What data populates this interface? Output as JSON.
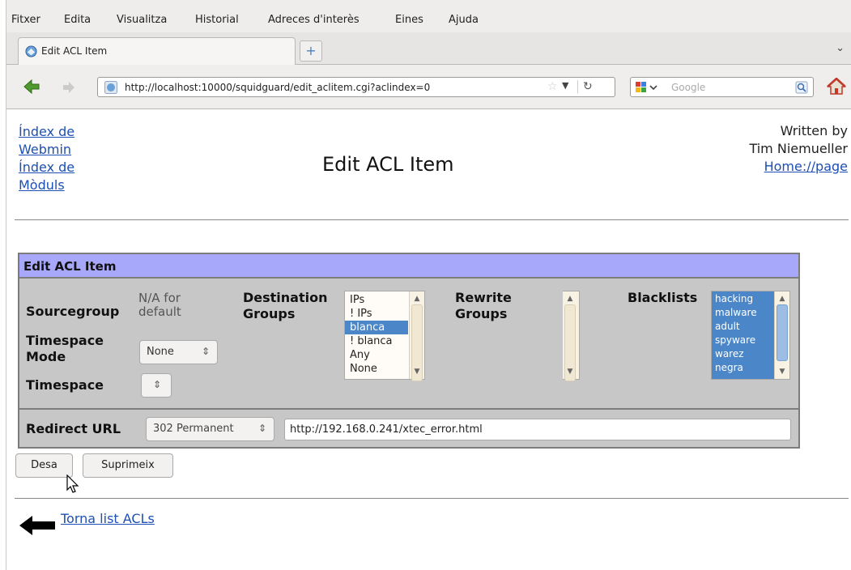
{
  "menu": [
    "Fitxer",
    "Edita",
    "Visualitza",
    "Historial",
    "Adreces d'interès",
    "Eines",
    "Ajuda"
  ],
  "tab": {
    "title": "Edit ACL Item",
    "new_tab": "+"
  },
  "navbar": {
    "url": "http://localhost:10000/squidguard/edit_aclitem.cgi?aclindex=0",
    "search_engine": "Google"
  },
  "page": {
    "left_links": [
      "Índex de",
      "Webmin",
      "Índex de",
      "Mòduls"
    ],
    "title": "Edit ACL Item",
    "author_line1": "Written by",
    "author_line2": "Tim Niemueller",
    "home_link": "Home://page"
  },
  "form": {
    "header": "Edit ACL Item",
    "sourcegroup_label": "Sourcegroup",
    "sourcegroup_value": "N/A for default",
    "timespace_mode_label": "Timespace Mode",
    "timespace_mode_value": "None",
    "timespace_label": "Timespace",
    "timespace_value": "",
    "destination_label": "Destination Groups",
    "destination_options": [
      {
        "label": "IPs",
        "selected": false
      },
      {
        "label": "! IPs",
        "selected": false
      },
      {
        "label": "blanca",
        "selected": true
      },
      {
        "label": "! blanca",
        "selected": false
      },
      {
        "label": "Any",
        "selected": false
      },
      {
        "label": "None",
        "selected": false
      }
    ],
    "rewrite_label": "Rewrite Groups",
    "blacklists_label": "Blacklists",
    "blacklists_options": [
      "hacking",
      "malware",
      "adult",
      "spyware",
      "warez",
      "negra"
    ],
    "redirect_label": "Redirect URL",
    "redirect_type": "302 Permanent",
    "redirect_url": "http://192.168.0.241/xtec_error.html"
  },
  "buttons": {
    "save": "Desa",
    "delete": "Suprimeix"
  },
  "return_link": "Torna list ACLs",
  "colors": {
    "header_bg": "#a8a8fb",
    "form_bg": "#c7c7c7",
    "link": "#1d4fb4",
    "selection": "#4a86c8"
  }
}
